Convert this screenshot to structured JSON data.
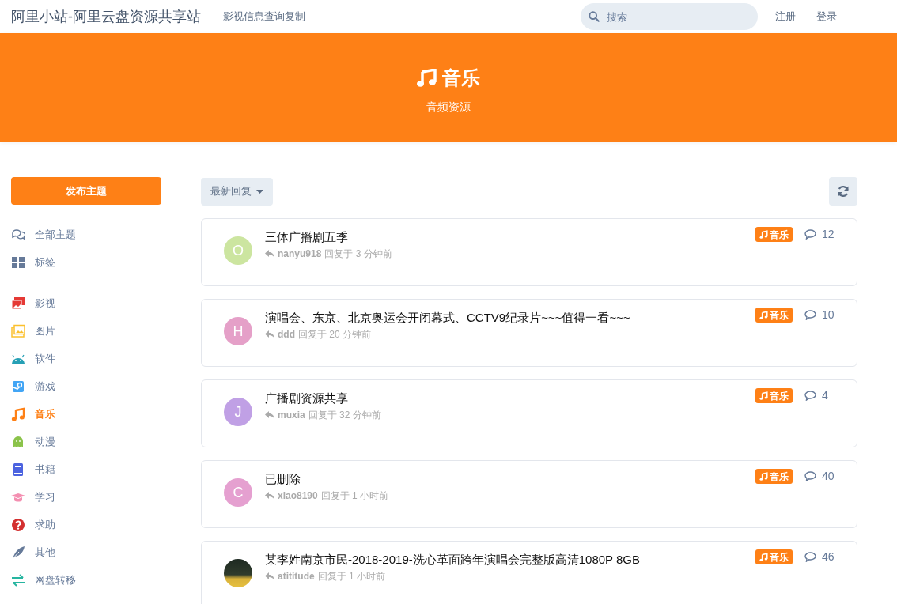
{
  "header": {
    "site_title": "阿里小站-阿里云盘资源共享站",
    "nav_link": "影视信息查询复制",
    "search": {
      "placeholder": "搜索"
    },
    "links": [
      "注册",
      "登录"
    ]
  },
  "hero": {
    "title": "音乐",
    "subtitle": "音频资源"
  },
  "sidebar": {
    "start_button": "发布主题",
    "nav": [
      {
        "label": "全部主题",
        "selected": false,
        "color": "#667a99"
      },
      {
        "label": "标签",
        "selected": false,
        "color": "#667a99"
      }
    ],
    "tags": [
      {
        "label": "影视",
        "selected": false,
        "color": "#e53935"
      },
      {
        "label": "图片",
        "selected": false,
        "color": "#fbc02d"
      },
      {
        "label": "软件",
        "selected": false,
        "color": "#26a0b5"
      },
      {
        "label": "游戏",
        "selected": false,
        "color": "#42a5f5"
      },
      {
        "label": "音乐",
        "selected": true,
        "color": "#fe8016"
      },
      {
        "label": "动漫",
        "selected": false,
        "color": "#8bc34a"
      },
      {
        "label": "书籍",
        "selected": false,
        "color": "#4c63e0"
      },
      {
        "label": "学习",
        "selected": false,
        "color": "#f48fb1"
      },
      {
        "label": "求助",
        "selected": false,
        "color": "#d32f2f"
      },
      {
        "label": "其他",
        "selected": false,
        "color": "#667a99"
      },
      {
        "label": "网盘转移",
        "selected": false,
        "color": "#26b5a0"
      }
    ]
  },
  "toolbar": {
    "sort": "最新回复"
  },
  "discussions": [
    {
      "avatar": {
        "kind": "letter",
        "letter": "O",
        "color": "#cce5a0"
      },
      "title": "三体广播剧五季",
      "user": "nanyu918",
      "time": "回复于 3 分钟前",
      "tag": "音乐",
      "replies": "12"
    },
    {
      "avatar": {
        "kind": "letter",
        "letter": "H",
        "color": "#e5a0c8"
      },
      "title": "演唱会、东京、北京奥运会开闭幕式、CCTV9纪录片~~~值得一看~~~",
      "user": "ddd",
      "time": "回复于 20 分钟前",
      "tag": "音乐",
      "replies": "10"
    },
    {
      "avatar": {
        "kind": "letter",
        "letter": "J",
        "color": "#c0a0e5"
      },
      "title": "广播剧资源共享",
      "user": "muxia",
      "time": "回复于 32 分钟前",
      "tag": "音乐",
      "replies": "4"
    },
    {
      "avatar": {
        "kind": "letter",
        "letter": "C",
        "color": "#e5a0d0"
      },
      "title": "已删除",
      "user": "xiao8190",
      "time": "回复于 1 小时前",
      "tag": "音乐",
      "replies": "40"
    },
    {
      "avatar": {
        "kind": "photo"
      },
      "title": "某李姓南京市民-2018-2019-洗心革面跨年演唱会完整版高清1080P 8GB",
      "user": "atititude",
      "time": "回复于 1 小时前",
      "tag": "音乐",
      "replies": "46"
    }
  ]
}
